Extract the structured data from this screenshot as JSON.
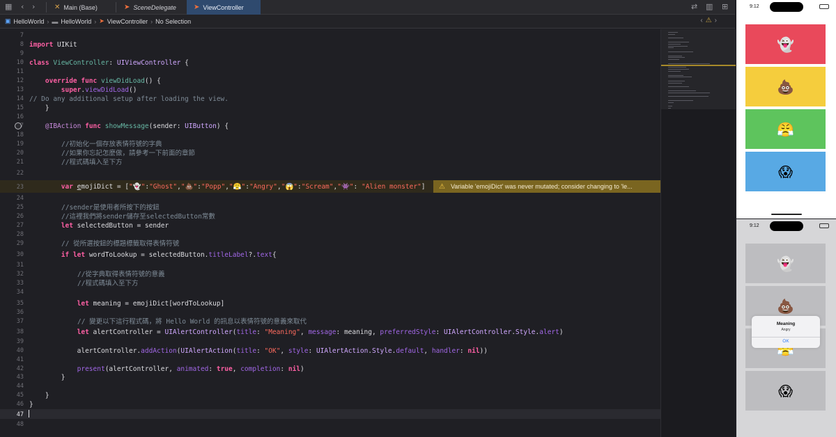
{
  "tabs": [
    {
      "label": "Main (Base)",
      "icon": "xib-icon"
    },
    {
      "label": "SceneDelegate",
      "icon": "swift-icon"
    },
    {
      "label": "ViewController",
      "icon": "swift-icon",
      "active": true
    }
  ],
  "breadcrumb": [
    "HelloWorld",
    "HelloWorld",
    "ViewController",
    "No Selection"
  ],
  "editor": {
    "line_numbers": [
      "7",
      "8",
      "9",
      "10",
      "11",
      "12",
      "13",
      "14",
      "15",
      "16",
      "17",
      "18",
      "19",
      "20",
      "21",
      "22",
      "23",
      "24",
      "25",
      "26",
      "27",
      "28",
      "29",
      "30",
      "31",
      "32",
      "33",
      "34",
      "35",
      "36",
      "37",
      "38",
      "39",
      "40",
      "41",
      "42",
      "43",
      "44",
      "45",
      "46",
      "47",
      "48"
    ],
    "current_line": "47",
    "warning": "Variable 'emojiDict' was never mutated; consider changing to 'le...",
    "comments": {
      "l14": "// Do any additional setup after loading the view.",
      "l19": "//初始化一個存放表情符號的字典",
      "l20": "//如果你忘記怎麼做，請參考一下前面的章節",
      "l21": "//程式碼填入至下方",
      "l25": "//sender是使用者所按下的按鈕",
      "l26": "//這裡我們將sender儲存至selectedButton常數",
      "l29": "// 從所選按鈕的標題標籤取得表情符號",
      "l32": "//從字典取得表情符號的意義",
      "l33": "//程式碼填入至下方",
      "l37": "// 變更以下這行程式碼，將 Hello World 的訊息以表情符號的意義來取代"
    }
  },
  "simulator_top": {
    "time": "9:12",
    "buttons": [
      {
        "emoji": "👻",
        "color": "#e9495b"
      },
      {
        "emoji": "💩",
        "color": "#f5cd3d"
      },
      {
        "emoji": "😤",
        "color": "#5ec45d"
      },
      {
        "emoji": "😱",
        "color": "#58a9e4"
      }
    ]
  },
  "simulator_bottom": {
    "time": "9:12",
    "buttons": [
      "👻",
      "💩",
      "😤",
      "😱"
    ],
    "alert": {
      "title": "Meaning",
      "message": "Angry",
      "ok": "OK"
    }
  }
}
